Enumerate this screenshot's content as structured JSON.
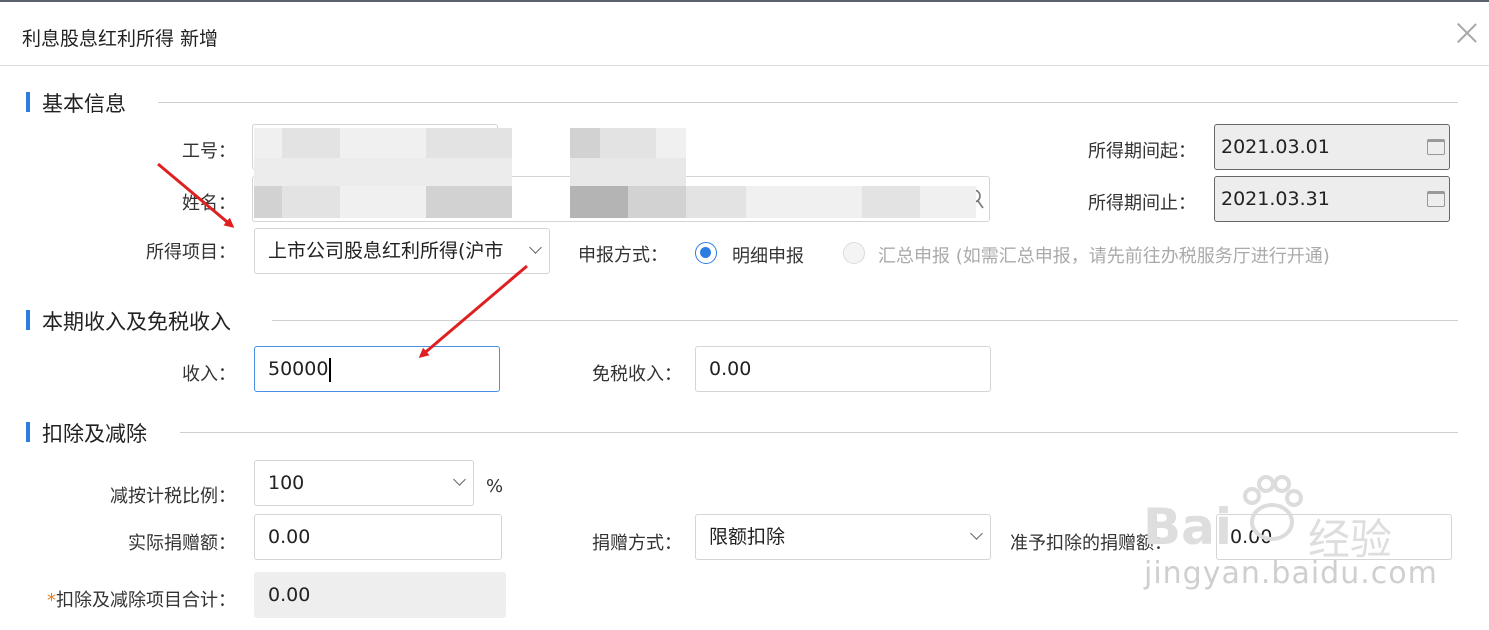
{
  "dialog": {
    "title": "利息股息红利所得 新增"
  },
  "sections": {
    "basic": "基本信息",
    "income": "本期收入及免税收入",
    "deduction": "扣除及减除"
  },
  "basic": {
    "employee_id_label": "工号：",
    "name_label": "姓名：",
    "income_item_label": "所得项目：",
    "income_item_value": "上市公司股息红利所得(沪市",
    "period_start_label": "所得期间起：",
    "period_start_value": "2021.03.01",
    "period_end_label": "所得期间止：",
    "period_end_value": "2021.03.31",
    "report_method_label": "申报方式：",
    "report_detail_label": "明细申报",
    "report_summary_label": "汇总申报 (如需汇总申报，请先前往办税服务厅进行开通)"
  },
  "income": {
    "income_label": "收入：",
    "income_value": "50000",
    "tax_free_label": "免税收入：",
    "tax_free_value": "0.00"
  },
  "deduction": {
    "ratio_label": "减按计税比例：",
    "ratio_value": "100",
    "ratio_unit": "%",
    "donation_label": "实际捐赠额：",
    "donation_value": "0.00",
    "donation_method_label": "捐赠方式：",
    "donation_method_value": "限额扣除",
    "allowed_donation_label": "准予扣除的捐赠额：",
    "allowed_donation_value": "0.00",
    "total_required_mark": "*",
    "total_label": "扣除及减除项目合计：",
    "total_value": "0.00"
  },
  "watermark": {
    "brand": "Bai",
    "brand_cn": "经验",
    "url": "jingyan.baidu.com"
  },
  "colors": {
    "accent": "#2b7de0",
    "arrow": "#e02020",
    "required": "#e67e22"
  }
}
